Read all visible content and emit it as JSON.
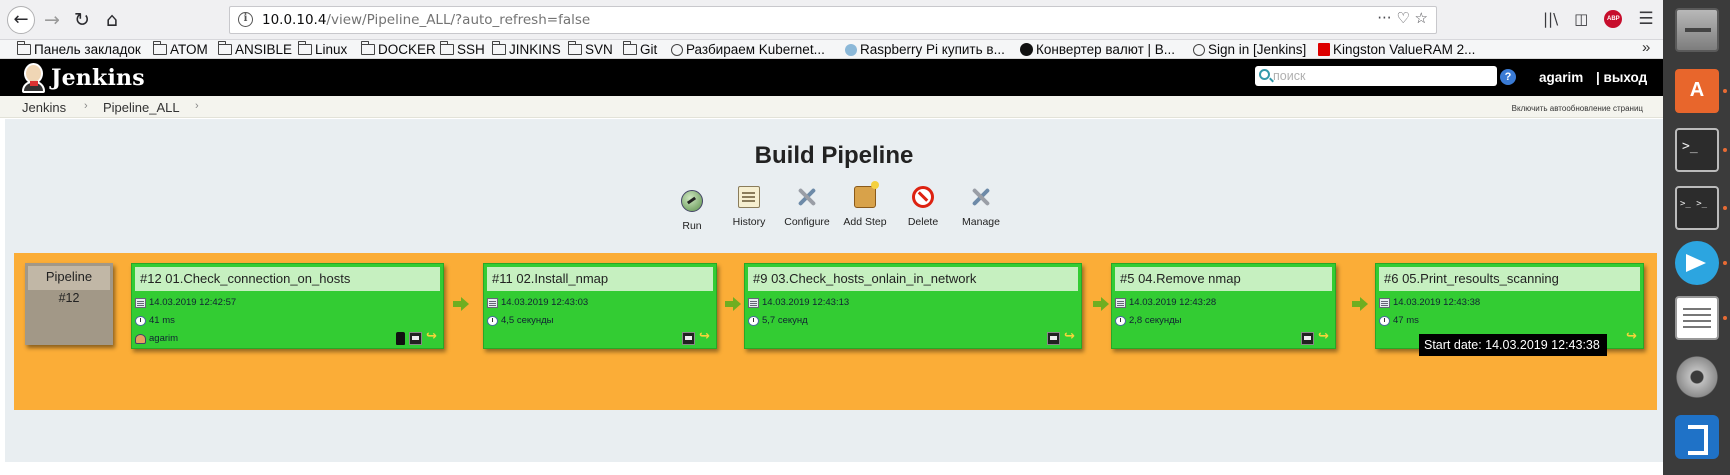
{
  "browser": {
    "url_host": "10.0.10.4",
    "url_path": "/view/Pipeline_ALL/?auto_refresh=false",
    "url_actions": "··· ♡ ☆",
    "bookmarks": [
      "Панель закладок",
      "ATOM",
      "ANSIBLE",
      "Linux",
      "DOCKER",
      "SSH",
      "JINKINS",
      "SVN",
      "Git",
      "Разбираем Kubernet...",
      "Raspberry Pi купить в...",
      "Конвертер валют | В...",
      "Sign in [Jenkins]",
      "Kingston ValueRAM 2..."
    ],
    "bookmarks_more": "»",
    "abp_label": "ABP"
  },
  "jenkins": {
    "title": "Jenkins",
    "search_placeholder": "поиск",
    "help": "?",
    "user": "agarim",
    "logout": "| выход",
    "breadcrumb": [
      "Jenkins",
      "Pipeline_ALL"
    ],
    "breadcrumb_sep": "›",
    "autorefresh": "Включить автообновление страниц"
  },
  "pipeline": {
    "title": "Build Pipeline",
    "toolbar": [
      "Run",
      "History",
      "Configure",
      "Add Step",
      "Delete",
      "Manage"
    ],
    "head_label": "Pipeline",
    "head_number": "#12",
    "builds": [
      {
        "title": "#12 01.Check_connection_on_hosts",
        "date": "14.03.2019 12:42:57",
        "duration": "41 ms",
        "user": "agarim",
        "status_color": "#33cc33"
      },
      {
        "title": "#11 02.Install_nmap",
        "date": "14.03.2019 12:43:03",
        "duration": "4,5 секунды",
        "status_color": "#33cc33"
      },
      {
        "title": "#9 03.Check_hosts_onlain_in_network",
        "date": "14.03.2019 12:43:13",
        "duration": "5,7 секунд",
        "status_color": "#33cc33"
      },
      {
        "title": "#5 04.Remove nmap",
        "date": "14.03.2019 12:43:28",
        "duration": "2,8 секунды",
        "status_color": "#33cc33"
      },
      {
        "title": "#6 05.Print_resoults_scanning",
        "date": "14.03.2019 12:43:38",
        "duration": "47 ms",
        "status_color": "#33cc33"
      }
    ],
    "tooltip": "Start date: 14.03.2019 12:43:38",
    "band_color": "#fbad37"
  },
  "launcher": {
    "apps": [
      "files-icon",
      "software-center-icon",
      "terminal-icon",
      "terminal-split-icon",
      "telegram-icon",
      "text-editor-icon",
      "settings-icon",
      "vscode-icon"
    ]
  }
}
